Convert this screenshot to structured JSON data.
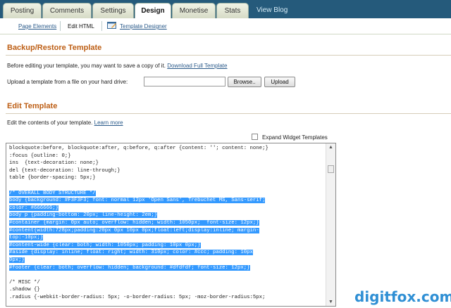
{
  "top_tabs": [
    {
      "label": "Posting",
      "active": false
    },
    {
      "label": "Comments",
      "active": false
    },
    {
      "label": "Settings",
      "active": false
    },
    {
      "label": "Design",
      "active": true
    },
    {
      "label": "Monetise",
      "active": false
    },
    {
      "label": "Stats",
      "active": false
    }
  ],
  "view_blog": "View Blog",
  "subtabs": {
    "page_elements": "Page Elements",
    "edit_html": "Edit HTML",
    "template_designer": "Template Designer"
  },
  "backup": {
    "heading": "Backup/Restore Template",
    "intro": "Before editing your template, you may want to save a copy of it.",
    "download_link": "Download Full Template",
    "upload_label": "Upload a template from a file on your hard drive:",
    "browse_button": "Browse..",
    "upload_button": "Upload"
  },
  "edit": {
    "heading": "Edit Template",
    "intro": "Edit the contents of your template.",
    "learn_more": "Learn more",
    "expand_widgets_label": "Expand Widget Templates"
  },
  "code_lines": [
    {
      "text": "blockquote:before, blockquote:after, q:before, q:after {content: ''; content: none;}",
      "selected": false
    },
    {
      "text": ":focus {outline: 0;}",
      "selected": false
    },
    {
      "text": "ins  {text-decoration: none;}",
      "selected": false
    },
    {
      "text": "del {text-decoration: line-through;}",
      "selected": false
    },
    {
      "text": "table {border-spacing: 5px;}",
      "selected": false
    },
    {
      "text": "",
      "selected": false
    },
    {
      "text": "/* OVERALL BODY STRUCTURE */",
      "selected": true
    },
    {
      "text": "body {background: #F3F3F3; font: normal 12px 'Open Sans', Trebuchet MS, Sans-serif;",
      "selected": true
    },
    {
      "text": "color: #666666;}",
      "selected": true
    },
    {
      "text": "body p {padding-bottom: 20px; line-height: 2em;}",
      "selected": true
    },
    {
      "text": "#container {margin: 0px auto; overflow: hidden; width: 1050px;  font-size: 12px;}",
      "selected": true
    },
    {
      "text": "#content{width:728px;padding:20px 0px 10px 0px;float:left;display:inline; margin-",
      "selected": true
    },
    {
      "text": "top:-10px;}",
      "selected": true
    },
    {
      "text": "#content-wide {clear: both; width: 1050px; padding: 10px 0px;}",
      "selected": true
    },
    {
      "text": "#aside {display: inline; float: right; width: 310px; color: #ccc; padding: 10px",
      "selected": true
    },
    {
      "text": "0px;}",
      "selected": true
    },
    {
      "text": "#footer {clear: both; overflow: hidden; background: #dfdfdf; font-size: 12px;}",
      "selected": true
    },
    {
      "text": "",
      "selected": false
    },
    {
      "text": "/* MISC */",
      "selected": false
    },
    {
      "text": ".shadow {}",
      "selected": false
    },
    {
      "text": ".radius {-webkit-border-radius: 5px; -o-border-radius: 5px; -moz-border-radius:5px;",
      "selected": false
    }
  ],
  "watermark": "digitfox.com"
}
